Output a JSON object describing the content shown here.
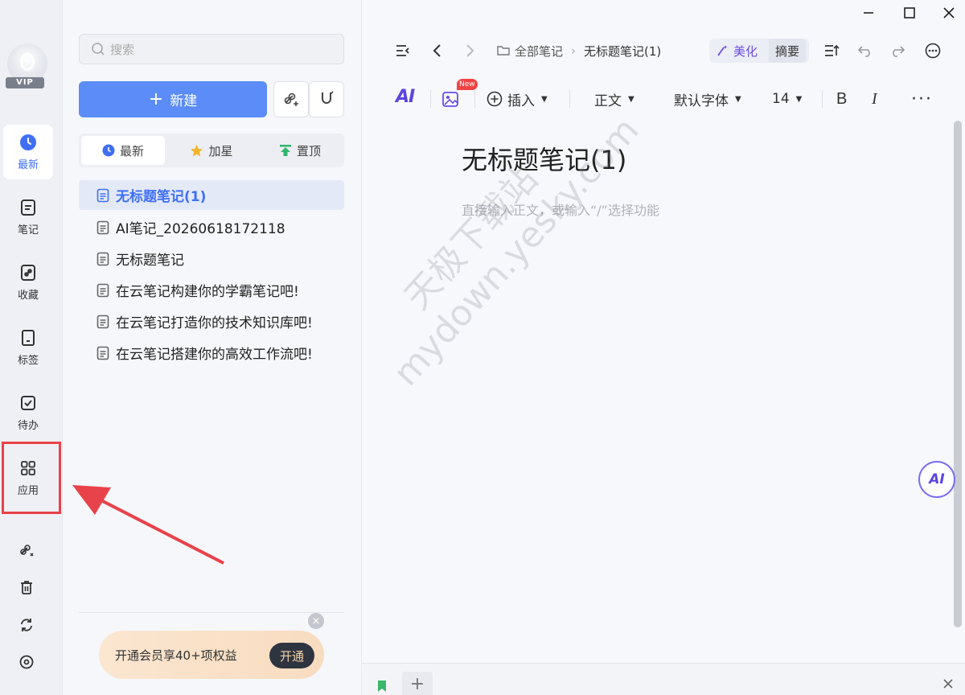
{
  "rail": {
    "vip_label": "VIP",
    "items": [
      {
        "label": "最新",
        "icon": "clock-icon",
        "active": true
      },
      {
        "label": "笔记",
        "icon": "note-icon"
      },
      {
        "label": "收藏",
        "icon": "link-icon"
      },
      {
        "label": "标签",
        "icon": "tag-icon"
      },
      {
        "label": "待办",
        "icon": "checkbox-icon"
      },
      {
        "label": "应用",
        "icon": "grid-apps-icon"
      }
    ],
    "bottom_icons": [
      "link-magic-icon",
      "trash-icon",
      "sync-icon",
      "settings-icon"
    ]
  },
  "list": {
    "search_placeholder": "搜索",
    "new_label": "新建",
    "tabs": [
      {
        "label": "最新",
        "icon": "clock-icon",
        "active": true
      },
      {
        "label": "加星",
        "icon": "star-icon"
      },
      {
        "label": "置顶",
        "icon": "pin-top-icon"
      }
    ],
    "notes": [
      {
        "title": "无标题笔记(1)",
        "active": true
      },
      {
        "title": "AI笔记_20260618172118"
      },
      {
        "title": "无标题笔记"
      },
      {
        "title": "在云笔记构建你的学霸笔记吧!"
      },
      {
        "title": "在云笔记打造你的技术知识库吧!"
      },
      {
        "title": "在云笔记搭建你的高效工作流吧!"
      }
    ],
    "promo_text": "开通会员享40+项权益",
    "promo_button": "开通"
  },
  "editor": {
    "breadcrumb_root": "全部笔记",
    "breadcrumb_current": "无标题笔记(1)",
    "beautify_label": "美化",
    "summary_label": "摘要",
    "ai_label": "AI",
    "new_badge": "New",
    "insert_label": "插入",
    "paragraph_label": "正文",
    "font_label": "默认字体",
    "size_label": "14",
    "bold_label": "B",
    "italic_label": "I",
    "title": "无标题笔记(1)",
    "placeholder": "直接输入正文，或输入“/”选择功能",
    "ai_float_label": "AI"
  },
  "watermark": {
    "line1": "天极下载站",
    "line2": "mydown.yesky.com"
  },
  "colors": {
    "accent": "#5b8cf7",
    "highlight": "#e8424a",
    "ai_purple": "#5c44e0"
  }
}
